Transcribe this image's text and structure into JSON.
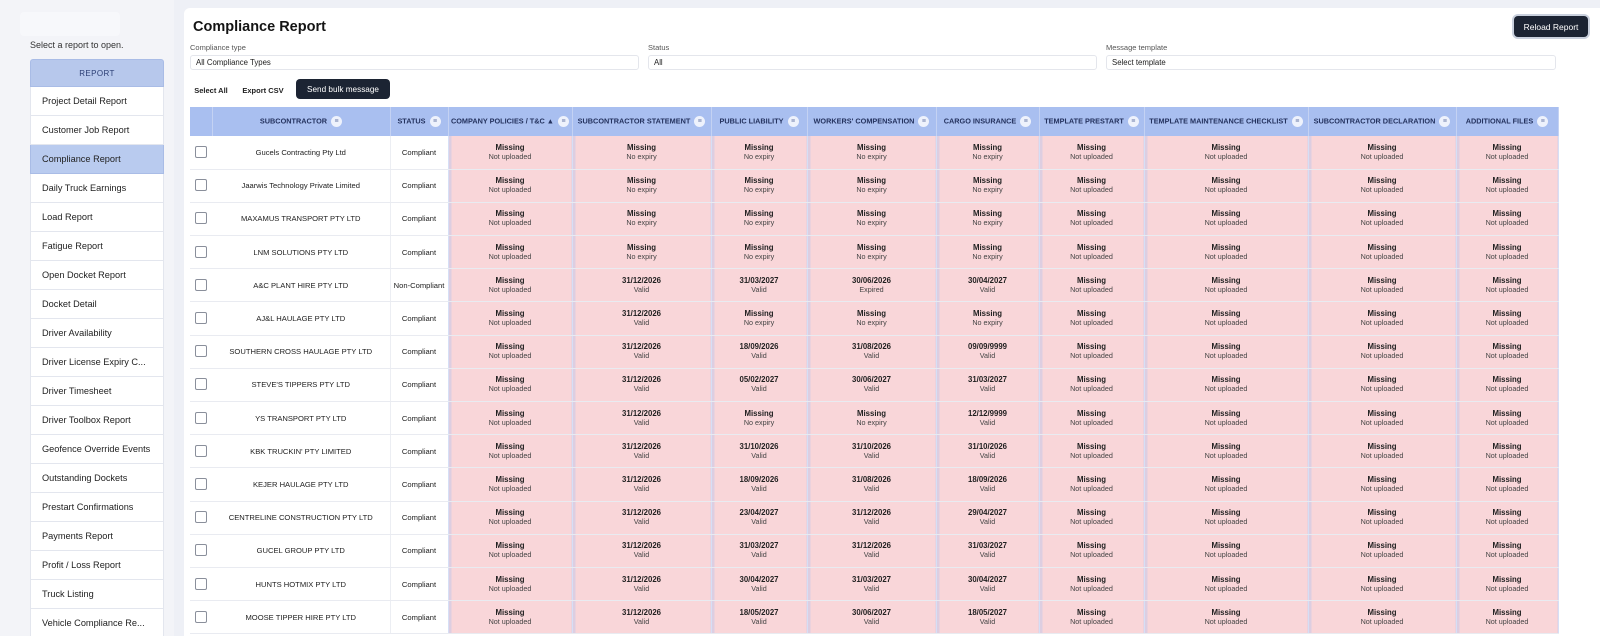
{
  "sidebar": {
    "hint": "Select a report to open.",
    "header": "REPORT",
    "items": [
      "Project Detail Report",
      "Customer Job Report",
      "Compliance Report",
      "Daily Truck Earnings",
      "Load Report",
      "Fatigue Report",
      "Open Docket Report",
      "Docket Detail",
      "Driver Availability",
      "Driver License Expiry C...",
      "Driver Timesheet",
      "Driver Toolbox Report",
      "Geofence Override Events",
      "Outstanding Dockets",
      "Prestart Confirmations",
      "Payments Report",
      "Profit / Loss Report",
      "Truck Listing",
      "Vehicle Compliance Re..."
    ],
    "active_index": 2
  },
  "header": {
    "title": "Compliance Report",
    "reload_label": "Reload Report"
  },
  "filters": {
    "compliance_type": {
      "label": "Compliance type",
      "value": "All Compliance Types"
    },
    "status": {
      "label": "Status",
      "value": "All"
    },
    "message_template": {
      "label": "Message template",
      "value": "Select template"
    }
  },
  "actions": {
    "select_all": "Select All",
    "export_csv": "Export CSV",
    "send_bulk": "Send bulk message"
  },
  "table": {
    "columns": [
      "SUBCONTRACTOR",
      "STATUS",
      "COMPANY POLICIES / T&C ▲",
      "SUBCONTRACTOR STATEMENT",
      "PUBLIC LIABILITY",
      "WORKERS' COMPENSATION",
      "CARGO INSURANCE",
      "TEMPLATE PRESTART",
      "TEMPLATE MAINTENANCE CHECKLIST",
      "SUBCONTRACTOR DECLARATION",
      "ADDITIONAL FILES"
    ],
    "rows": [
      {
        "name": "Gucels Contracting Pty Ltd",
        "status": "Compliant",
        "cells": [
          [
            "Missing",
            "Not uploaded"
          ],
          [
            "Missing",
            "No expiry"
          ],
          [
            "Missing",
            "No expiry"
          ],
          [
            "Missing",
            "No expiry"
          ],
          [
            "Missing",
            "No expiry"
          ],
          [
            "Missing",
            "Not uploaded"
          ],
          [
            "Missing",
            "Not uploaded"
          ],
          [
            "Missing",
            "Not uploaded"
          ],
          [
            "Missing",
            "Not uploaded"
          ]
        ]
      },
      {
        "name": "Jaarwis Technology Private Limited",
        "status": "Compliant",
        "cells": [
          [
            "Missing",
            "Not uploaded"
          ],
          [
            "Missing",
            "No expiry"
          ],
          [
            "Missing",
            "No expiry"
          ],
          [
            "Missing",
            "No expiry"
          ],
          [
            "Missing",
            "No expiry"
          ],
          [
            "Missing",
            "Not uploaded"
          ],
          [
            "Missing",
            "Not uploaded"
          ],
          [
            "Missing",
            "Not uploaded"
          ],
          [
            "Missing",
            "Not uploaded"
          ]
        ]
      },
      {
        "name": "MAXAMUS TRANSPORT PTY LTD",
        "status": "Compliant",
        "cells": [
          [
            "Missing",
            "Not uploaded"
          ],
          [
            "Missing",
            "No expiry"
          ],
          [
            "Missing",
            "No expiry"
          ],
          [
            "Missing",
            "No expiry"
          ],
          [
            "Missing",
            "No expiry"
          ],
          [
            "Missing",
            "Not uploaded"
          ],
          [
            "Missing",
            "Not uploaded"
          ],
          [
            "Missing",
            "Not uploaded"
          ],
          [
            "Missing",
            "Not uploaded"
          ]
        ]
      },
      {
        "name": "LNM SOLUTIONS PTY LTD",
        "status": "Compliant",
        "cells": [
          [
            "Missing",
            "Not uploaded"
          ],
          [
            "Missing",
            "No expiry"
          ],
          [
            "Missing",
            "No expiry"
          ],
          [
            "Missing",
            "No expiry"
          ],
          [
            "Missing",
            "No expiry"
          ],
          [
            "Missing",
            "Not uploaded"
          ],
          [
            "Missing",
            "Not uploaded"
          ],
          [
            "Missing",
            "Not uploaded"
          ],
          [
            "Missing",
            "Not uploaded"
          ]
        ]
      },
      {
        "name": "A&C PLANT HIRE PTY LTD",
        "status": "Non-Compliant",
        "cells": [
          [
            "Missing",
            "Not uploaded"
          ],
          [
            "31/12/2026",
            "Valid"
          ],
          [
            "31/03/2027",
            "Valid"
          ],
          [
            "30/06/2026",
            "Expired"
          ],
          [
            "30/04/2027",
            "Valid"
          ],
          [
            "Missing",
            "Not uploaded"
          ],
          [
            "Missing",
            "Not uploaded"
          ],
          [
            "Missing",
            "Not uploaded"
          ],
          [
            "Missing",
            "Not uploaded"
          ]
        ]
      },
      {
        "name": "AJ&L HAULAGE PTY LTD",
        "status": "Compliant",
        "cells": [
          [
            "Missing",
            "Not uploaded"
          ],
          [
            "31/12/2026",
            "Valid"
          ],
          [
            "Missing",
            "No expiry"
          ],
          [
            "Missing",
            "No expiry"
          ],
          [
            "Missing",
            "No expiry"
          ],
          [
            "Missing",
            "Not uploaded"
          ],
          [
            "Missing",
            "Not uploaded"
          ],
          [
            "Missing",
            "Not uploaded"
          ],
          [
            "Missing",
            "Not uploaded"
          ]
        ]
      },
      {
        "name": "SOUTHERN CROSS HAULAGE PTY LTD",
        "status": "Compliant",
        "cells": [
          [
            "Missing",
            "Not uploaded"
          ],
          [
            "31/12/2026",
            "Valid"
          ],
          [
            "18/09/2026",
            "Valid"
          ],
          [
            "31/08/2026",
            "Valid"
          ],
          [
            "09/09/9999",
            "Valid"
          ],
          [
            "Missing",
            "Not uploaded"
          ],
          [
            "Missing",
            "Not uploaded"
          ],
          [
            "Missing",
            "Not uploaded"
          ],
          [
            "Missing",
            "Not uploaded"
          ]
        ]
      },
      {
        "name": "STEVE'S TIPPERS PTY LTD",
        "status": "Compliant",
        "cells": [
          [
            "Missing",
            "Not uploaded"
          ],
          [
            "31/12/2026",
            "Valid"
          ],
          [
            "05/02/2027",
            "Valid"
          ],
          [
            "30/06/2027",
            "Valid"
          ],
          [
            "31/03/2027",
            "Valid"
          ],
          [
            "Missing",
            "Not uploaded"
          ],
          [
            "Missing",
            "Not uploaded"
          ],
          [
            "Missing",
            "Not uploaded"
          ],
          [
            "Missing",
            "Not uploaded"
          ]
        ]
      },
      {
        "name": "YS TRANSPORT PTY LTD",
        "status": "Compliant",
        "cells": [
          [
            "Missing",
            "Not uploaded"
          ],
          [
            "31/12/2026",
            "Valid"
          ],
          [
            "Missing",
            "No expiry"
          ],
          [
            "Missing",
            "No expiry"
          ],
          [
            "12/12/9999",
            "Valid"
          ],
          [
            "Missing",
            "Not uploaded"
          ],
          [
            "Missing",
            "Not uploaded"
          ],
          [
            "Missing",
            "Not uploaded"
          ],
          [
            "Missing",
            "Not uploaded"
          ]
        ]
      },
      {
        "name": "KBK TRUCKIN' PTY LIMITED",
        "status": "Compliant",
        "cells": [
          [
            "Missing",
            "Not uploaded"
          ],
          [
            "31/12/2026",
            "Valid"
          ],
          [
            "31/10/2026",
            "Valid"
          ],
          [
            "31/10/2026",
            "Valid"
          ],
          [
            "31/10/2026",
            "Valid"
          ],
          [
            "Missing",
            "Not uploaded"
          ],
          [
            "Missing",
            "Not uploaded"
          ],
          [
            "Missing",
            "Not uploaded"
          ],
          [
            "Missing",
            "Not uploaded"
          ]
        ]
      },
      {
        "name": "KEJER HAULAGE PTY LTD",
        "status": "Compliant",
        "cells": [
          [
            "Missing",
            "Not uploaded"
          ],
          [
            "31/12/2026",
            "Valid"
          ],
          [
            "18/09/2026",
            "Valid"
          ],
          [
            "31/08/2026",
            "Valid"
          ],
          [
            "18/09/2026",
            "Valid"
          ],
          [
            "Missing",
            "Not uploaded"
          ],
          [
            "Missing",
            "Not uploaded"
          ],
          [
            "Missing",
            "Not uploaded"
          ],
          [
            "Missing",
            "Not uploaded"
          ]
        ]
      },
      {
        "name": "CENTRELINE CONSTRUCTION PTY LTD",
        "status": "Compliant",
        "cells": [
          [
            "Missing",
            "Not uploaded"
          ],
          [
            "31/12/2026",
            "Valid"
          ],
          [
            "23/04/2027",
            "Valid"
          ],
          [
            "31/12/2026",
            "Valid"
          ],
          [
            "29/04/2027",
            "Valid"
          ],
          [
            "Missing",
            "Not uploaded"
          ],
          [
            "Missing",
            "Not uploaded"
          ],
          [
            "Missing",
            "Not uploaded"
          ],
          [
            "Missing",
            "Not uploaded"
          ]
        ]
      },
      {
        "name": "GUCEL GROUP PTY LTD",
        "status": "Compliant",
        "cells": [
          [
            "Missing",
            "Not uploaded"
          ],
          [
            "31/12/2026",
            "Valid"
          ],
          [
            "31/03/2027",
            "Valid"
          ],
          [
            "31/12/2026",
            "Valid"
          ],
          [
            "31/03/2027",
            "Valid"
          ],
          [
            "Missing",
            "Not uploaded"
          ],
          [
            "Missing",
            "Not uploaded"
          ],
          [
            "Missing",
            "Not uploaded"
          ],
          [
            "Missing",
            "Not uploaded"
          ]
        ]
      },
      {
        "name": "HUNTS HOTMIX PTY LTD",
        "status": "Compliant",
        "cells": [
          [
            "Missing",
            "Not uploaded"
          ],
          [
            "31/12/2026",
            "Valid"
          ],
          [
            "30/04/2027",
            "Valid"
          ],
          [
            "31/03/2027",
            "Valid"
          ],
          [
            "30/04/2027",
            "Valid"
          ],
          [
            "Missing",
            "Not uploaded"
          ],
          [
            "Missing",
            "Not uploaded"
          ],
          [
            "Missing",
            "Not uploaded"
          ],
          [
            "Missing",
            "Not uploaded"
          ]
        ]
      },
      {
        "name": "MOOSE TIPPER HIRE PTY LTD",
        "status": "Compliant",
        "cells": [
          [
            "Missing",
            "Not uploaded"
          ],
          [
            "31/12/2026",
            "Valid"
          ],
          [
            "18/05/2027",
            "Valid"
          ],
          [
            "30/06/2027",
            "Valid"
          ],
          [
            "18/05/2027",
            "Valid"
          ],
          [
            "Missing",
            "Not uploaded"
          ],
          [
            "Missing",
            "Not uploaded"
          ],
          [
            "Missing",
            "Not uploaded"
          ],
          [
            "Missing",
            "Not uploaded"
          ]
        ]
      }
    ]
  }
}
